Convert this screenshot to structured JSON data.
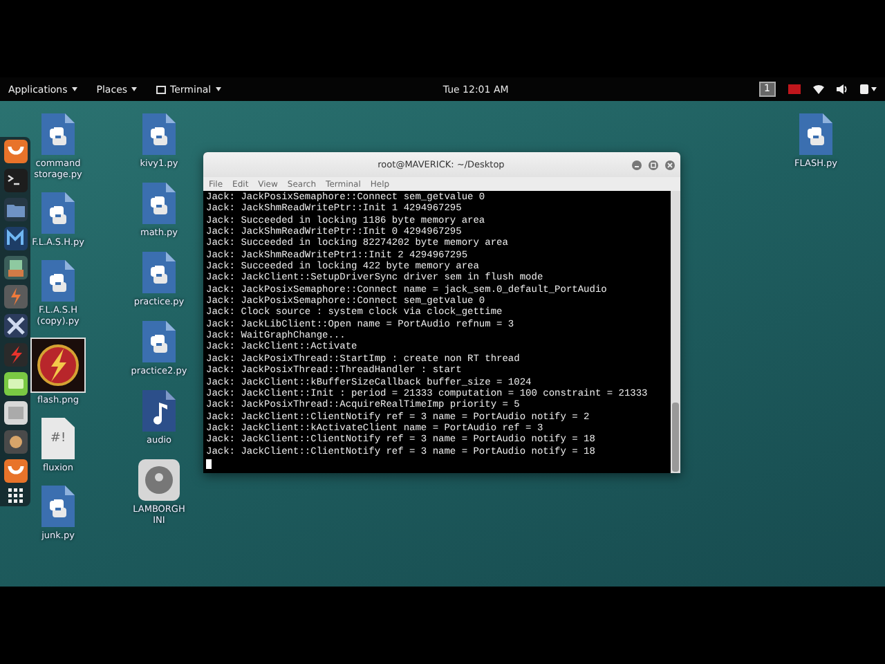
{
  "top_panel": {
    "menus": [
      "Applications",
      "Places",
      "Terminal"
    ],
    "clock": "Tue 12:01 AM",
    "workspace": "1"
  },
  "desktop": {
    "columns": [
      [
        {
          "label": "command storage.py",
          "kind": "python",
          "selected": false
        },
        {
          "label": "F.L.A.S.H.py",
          "kind": "python",
          "selected": false
        },
        {
          "label": "F.L.A.S.H (copy).py",
          "kind": "python",
          "selected": false
        },
        {
          "label": "flash.png",
          "kind": "image",
          "selected": true
        },
        {
          "label": "fluxion",
          "kind": "script",
          "glyph": "#!",
          "selected": false
        },
        {
          "label": "junk.py",
          "kind": "python",
          "selected": false
        }
      ],
      [
        {
          "label": "kivy1.py",
          "kind": "python",
          "selected": false
        },
        {
          "label": "math.py",
          "kind": "python",
          "selected": false
        },
        {
          "label": "practice.py",
          "kind": "python",
          "selected": false
        },
        {
          "label": "practice2.py",
          "kind": "python",
          "selected": false
        },
        {
          "label": "audio",
          "kind": "audio",
          "selected": false
        },
        {
          "label": "LAMBORGHINI",
          "kind": "drive",
          "selected": false
        }
      ],
      [
        {
          "label": "FLASH.py",
          "kind": "python",
          "selected": false
        }
      ]
    ]
  },
  "terminal": {
    "title": "root@MAVERICK: ~/Desktop",
    "menu": [
      "File",
      "Edit",
      "View",
      "Search",
      "Terminal",
      "Help"
    ],
    "lines": [
      "Jack: JackPosixSemaphore::Connect sem_getvalue 0",
      "Jack: JackShmReadWritePtr::Init 1 4294967295",
      "Jack: Succeeded in locking 1186 byte memory area",
      "Jack: JackShmReadWritePtr::Init 0 4294967295",
      "Jack: Succeeded in locking 82274202 byte memory area",
      "Jack: JackShmReadWritePtr1::Init 2 4294967295",
      "Jack: Succeeded in locking 422 byte memory area",
      "Jack: JackClient::SetupDriverSync driver sem in flush mode",
      "Jack: JackPosixSemaphore::Connect name = jack_sem.0_default_PortAudio",
      "Jack: JackPosixSemaphore::Connect sem_getvalue 0",
      "Jack: Clock source : system clock via clock_gettime",
      "Jack: JackLibClient::Open name = PortAudio refnum = 3",
      "Jack: WaitGraphChange...",
      "Jack: JackClient::Activate",
      "Jack: JackPosixThread::StartImp : create non RT thread",
      "Jack: JackPosixThread::ThreadHandler : start",
      "Jack: JackClient::kBufferSizeCallback buffer_size = 1024",
      "Jack: JackClient::Init : period = 21333 computation = 100 constraint = 21333",
      "Jack: JackPosixThread::AcquireRealTimeImp priority = 5",
      "Jack: JackClient::ClientNotify ref = 3 name = PortAudio notify = 2",
      "Jack: JackClient::kActivateClient name = PortAudio ref = 3",
      "Jack: JackClient::ClientNotify ref = 3 name = PortAudio notify = 18",
      "Jack: JackClient::ClientNotify ref = 3 name = PortAudio notify = 18"
    ]
  }
}
